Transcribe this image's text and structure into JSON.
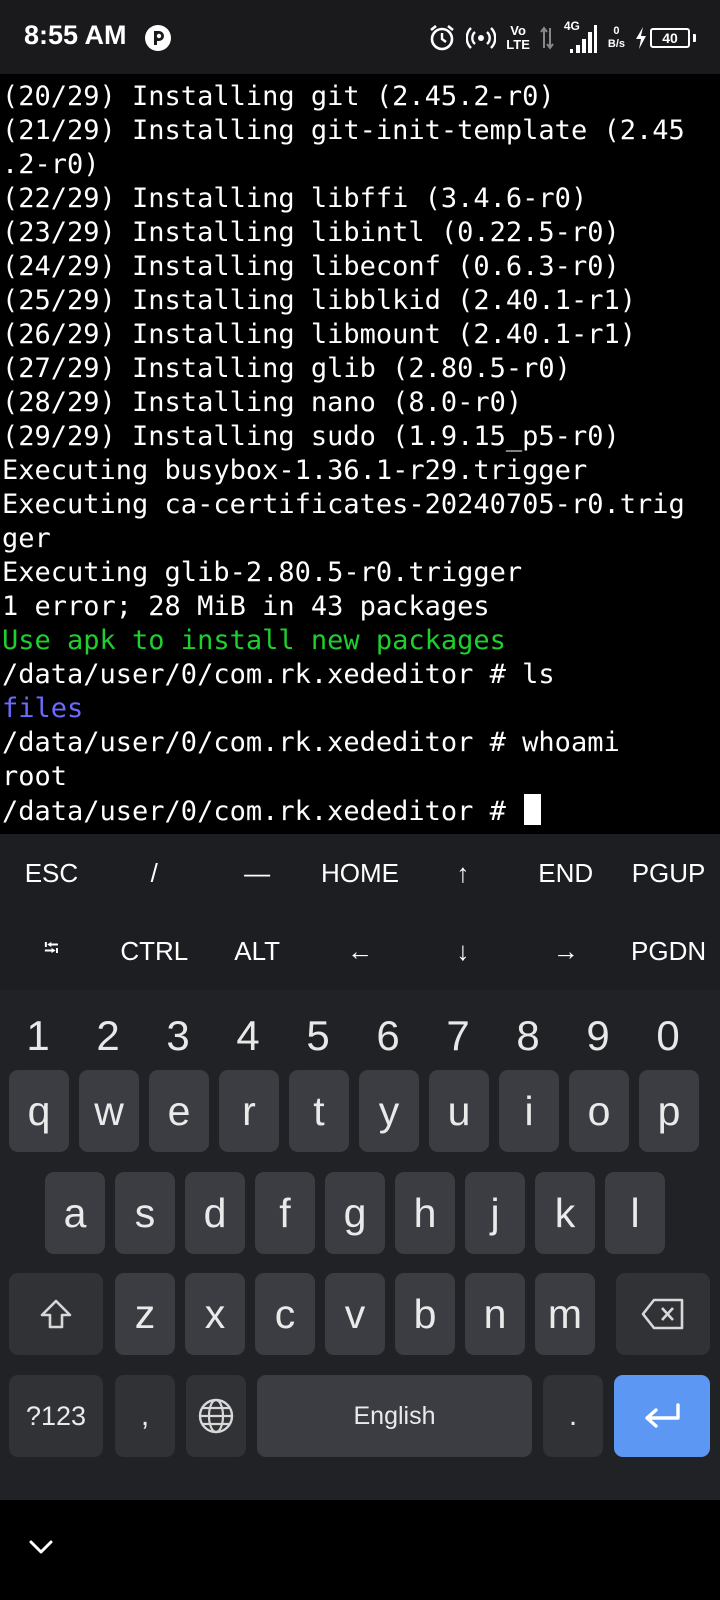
{
  "status_bar": {
    "time": "8:55 AM",
    "volte_top": "Vo",
    "volte_bottom": "LTE",
    "signal_label": "4G",
    "net_speed_value": "0",
    "net_speed_unit": "B/s",
    "battery_level": "40",
    "icons": [
      "app-notification-icon",
      "alarm-icon",
      "hotspot-icon",
      "data-arrows-icon",
      "signal-icon",
      "charging-bolt-icon",
      "battery-icon"
    ]
  },
  "terminal": {
    "lines": [
      {
        "text": "(20/29) Installing git (2.45.2-r0)",
        "color": "#ffffff"
      },
      {
        "text": "(21/29) Installing git-init-template (2.45",
        "color": "#ffffff"
      },
      {
        "text": ".2-r0)",
        "color": "#ffffff"
      },
      {
        "text": "(22/29) Installing libffi (3.4.6-r0)",
        "color": "#ffffff"
      },
      {
        "text": "(23/29) Installing libintl (0.22.5-r0)",
        "color": "#ffffff"
      },
      {
        "text": "(24/29) Installing libeconf (0.6.3-r0)",
        "color": "#ffffff"
      },
      {
        "text": "(25/29) Installing libblkid (2.40.1-r1)",
        "color": "#ffffff"
      },
      {
        "text": "(26/29) Installing libmount (2.40.1-r1)",
        "color": "#ffffff"
      },
      {
        "text": "(27/29) Installing glib (2.80.5-r0)",
        "color": "#ffffff"
      },
      {
        "text": "(28/29) Installing nano (8.0-r0)",
        "color": "#ffffff"
      },
      {
        "text": "(29/29) Installing sudo (1.9.15_p5-r0)",
        "color": "#ffffff"
      },
      {
        "text": "Executing busybox-1.36.1-r29.trigger",
        "color": "#ffffff"
      },
      {
        "text": "Executing ca-certificates-20240705-r0.trig",
        "color": "#ffffff"
      },
      {
        "text": "ger",
        "color": "#ffffff"
      },
      {
        "text": "Executing glib-2.80.5-r0.trigger",
        "color": "#ffffff"
      },
      {
        "text": "1 error; 28 MiB in 43 packages",
        "color": "#ffffff"
      },
      {
        "text": "Use apk to install new packages",
        "color": "#1fcf2e"
      },
      {
        "text": "/data/user/0/com.rk.xededitor # ls",
        "color": "#ffffff"
      },
      {
        "text": "files",
        "color": "#6b6bff"
      },
      {
        "text": "/data/user/0/com.rk.xededitor # whoami",
        "color": "#ffffff"
      },
      {
        "text": "root",
        "color": "#ffffff"
      }
    ],
    "prompt": "/data/user/0/com.rk.xededitor # "
  },
  "extra_keys": {
    "row1": [
      "ESC",
      "/",
      "—",
      "HOME",
      "↑",
      "END",
      "PGUP"
    ],
    "row2": [
      "⭾",
      "CTRL",
      "ALT",
      "←",
      "↓",
      "→",
      "PGDN"
    ]
  },
  "keyboard": {
    "numbers": [
      "1",
      "2",
      "3",
      "4",
      "5",
      "6",
      "7",
      "8",
      "9",
      "0"
    ],
    "row1": [
      "q",
      "w",
      "e",
      "r",
      "t",
      "y",
      "u",
      "i",
      "o",
      "p"
    ],
    "row2": [
      "a",
      "s",
      "d",
      "f",
      "g",
      "h",
      "j",
      "k",
      "l"
    ],
    "row3": [
      "z",
      "x",
      "c",
      "v",
      "b",
      "n",
      "m"
    ],
    "symbols_label": "?123",
    "comma_label": ",",
    "space_label": "English",
    "period_label": ".",
    "colors": {
      "key": "#3c3d42",
      "function_key": "#313236",
      "enter": "#5d97f4",
      "background": "#212226"
    }
  }
}
